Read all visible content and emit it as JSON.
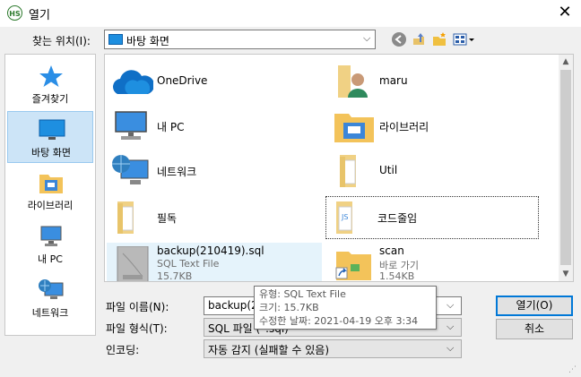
{
  "window": {
    "title": "열기",
    "app_icon_text": "HS",
    "close_glyph": "✕"
  },
  "location": {
    "label": "찾는 위치(I):",
    "value": "바탕 화면"
  },
  "toolbar": {
    "back_icon": "back-icon",
    "up_icon": "up-folder-icon",
    "new_folder_icon": "new-folder-icon",
    "view_icon": "view-menu-icon"
  },
  "places": [
    {
      "label": "즐겨찾기",
      "icon": "star-icon"
    },
    {
      "label": "바탕 화면",
      "icon": "desktop-icon",
      "selected": true
    },
    {
      "label": "라이브러리",
      "icon": "library-icon"
    },
    {
      "label": "내 PC",
      "icon": "computer-icon"
    },
    {
      "label": "네트워크",
      "icon": "network-icon"
    }
  ],
  "files": [
    {
      "name": "OneDrive",
      "icon": "cloud-icon"
    },
    {
      "name": "maru",
      "icon": "user-folder-icon"
    },
    {
      "name": "내 PC",
      "icon": "computer-icon"
    },
    {
      "name": "라이브러리",
      "icon": "library-icon"
    },
    {
      "name": "네트워크",
      "icon": "network-icon"
    },
    {
      "name": "Util",
      "icon": "folder-icon"
    },
    {
      "name": "필독",
      "icon": "folder-icon"
    },
    {
      "name": "코드줄임",
      "icon": "js-folder-icon"
    },
    {
      "name": "backup(210419).sql",
      "type": "SQL Text File",
      "size": "15.7KB",
      "icon": "sql-file-icon"
    },
    {
      "name": "scan",
      "type": "바로 가기",
      "size": "1.54KB",
      "icon": "shortcut-folder-icon"
    }
  ],
  "tooltip": {
    "type": "유형: SQL Text File",
    "size": "크기: 15.7KB",
    "modified": "수정한 날짜: 2021-04-19 오후 3:34"
  },
  "form": {
    "filename_label": "파일 이름(N):",
    "filename_value": "backup(210419).sql",
    "filetype_label": "파일 형식(T):",
    "filetype_value": "SQL 파일 (*.sql)",
    "encoding_label": "인코딩:",
    "encoding_value": "자동 감지 (실패할 수 있음)"
  },
  "buttons": {
    "open": "열기(O)",
    "cancel": "취소"
  },
  "colors": {
    "accent": "#0078d7",
    "selection": "#cce4f7",
    "hover": "#e5f3fb"
  }
}
